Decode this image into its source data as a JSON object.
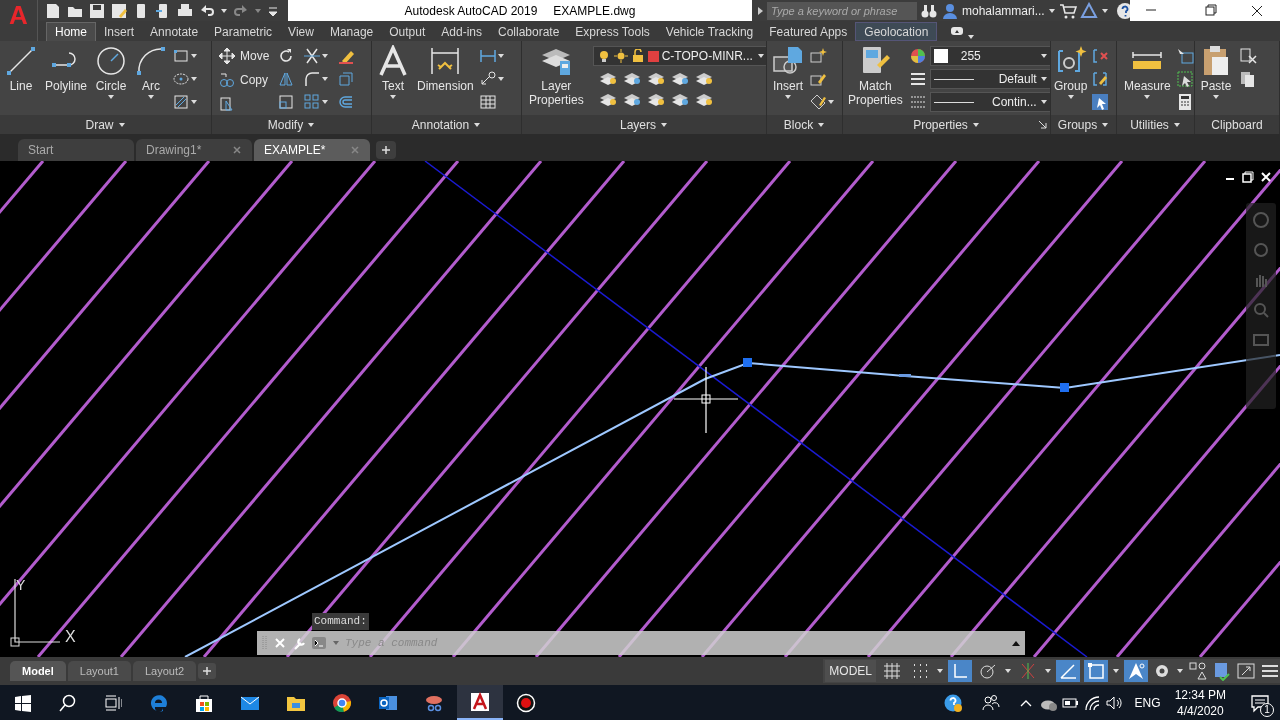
{
  "app_button": {
    "logo": "A"
  },
  "title": "Autodesk AutoCAD 2019",
  "document": "EXAMPLE.dwg",
  "search": {
    "placeholder": "Type a keyword or phrase"
  },
  "user": {
    "name": "mohalammari..."
  },
  "ribbon_tabs": [
    {
      "label": "Home",
      "selected": true,
      "contextual": false
    },
    {
      "label": "Insert",
      "selected": false,
      "contextual": false
    },
    {
      "label": "Annotate",
      "selected": false,
      "contextual": false
    },
    {
      "label": "Parametric",
      "selected": false,
      "contextual": false
    },
    {
      "label": "View",
      "selected": false,
      "contextual": false
    },
    {
      "label": "Manage",
      "selected": false,
      "contextual": false
    },
    {
      "label": "Output",
      "selected": false,
      "contextual": false
    },
    {
      "label": "Add-ins",
      "selected": false,
      "contextual": false
    },
    {
      "label": "Collaborate",
      "selected": false,
      "contextual": false
    },
    {
      "label": "Express Tools",
      "selected": false,
      "contextual": false
    },
    {
      "label": "Vehicle Tracking",
      "selected": false,
      "contextual": false
    },
    {
      "label": "Featured Apps",
      "selected": false,
      "contextual": false
    },
    {
      "label": "Geolocation",
      "selected": false,
      "contextual": true
    }
  ],
  "panels": [
    {
      "title": "Draw",
      "tools": [
        {
          "label": "Line",
          "dropdown": false
        },
        {
          "label": "Polyline",
          "dropdown": false
        },
        {
          "label": "Circle",
          "dropdown": true
        },
        {
          "label": "Arc",
          "dropdown": true
        }
      ]
    },
    {
      "title": "Modify",
      "small_tools": [
        {
          "label": "Move"
        },
        {
          "label": "Copy"
        }
      ]
    },
    {
      "title": "Annotation",
      "tools": [
        {
          "label": "Text",
          "dropdown": true
        },
        {
          "label": "Dimension",
          "dropdown": false
        }
      ]
    },
    {
      "title": "Layers",
      "tools": [
        {
          "label": "Layer Properties",
          "dropdown": false
        }
      ],
      "layer": {
        "value": "C-TOPO-MINR...",
        "color": "#e04040"
      }
    },
    {
      "title": "Block",
      "tools": [
        {
          "label": "Insert",
          "dropdown": true
        }
      ]
    },
    {
      "title": "Properties",
      "tools": [
        {
          "label": "Match Properties",
          "dropdown": false
        }
      ],
      "dropdowns": [
        {
          "value": "255"
        },
        {
          "value": "Default"
        },
        {
          "value": "Contin..."
        }
      ]
    },
    {
      "title": "Groups",
      "tools": [
        {
          "label": "Group",
          "dropdown": true
        }
      ]
    },
    {
      "title": "Utilities",
      "tools": [
        {
          "label": "Measure",
          "dropdown": true
        }
      ]
    },
    {
      "title": "Clipboard",
      "tools": [
        {
          "label": "Paste",
          "dropdown": true
        }
      ]
    }
  ],
  "document_tabs": [
    {
      "label": "Start",
      "selected": false,
      "closable": false
    },
    {
      "label": "Drawing1*",
      "selected": false,
      "closable": true
    },
    {
      "label": "EXAMPLE*",
      "selected": true,
      "closable": true
    }
  ],
  "ucs": {
    "y_label": "Y",
    "x_label": "X"
  },
  "command_line": {
    "label": "Command:",
    "placeholder": "Type a command"
  },
  "layout_tabs": [
    {
      "label": "Model",
      "selected": true
    },
    {
      "label": "Layout1",
      "selected": false
    },
    {
      "label": "Layout2",
      "selected": false
    }
  ],
  "status_bar": {
    "space": "MODEL",
    "toggles": [
      {
        "kind": "grid",
        "on": false
      },
      {
        "kind": "snap",
        "on": false
      },
      {
        "kind": "ortho",
        "on": true
      },
      {
        "kind": "polar",
        "on": false
      },
      {
        "kind": "track",
        "on": false
      },
      {
        "kind": "angle",
        "on": true
      },
      {
        "kind": "select",
        "on": true
      },
      {
        "kind": "annotate",
        "on": true
      }
    ]
  },
  "taskbar": {
    "apps": [
      {
        "kind": "edge",
        "active": false
      },
      {
        "kind": "store",
        "active": false
      },
      {
        "kind": "mail",
        "active": false
      },
      {
        "kind": "explorer",
        "active": false
      },
      {
        "kind": "chrome",
        "active": false
      },
      {
        "kind": "outlook",
        "active": false
      },
      {
        "kind": "snip",
        "active": false
      },
      {
        "kind": "autocad",
        "active": true
      },
      {
        "kind": "recorder",
        "active": false
      }
    ],
    "language": "ENG",
    "time": "12:34 PM",
    "date": "4/4/2020",
    "notifications": "1"
  }
}
